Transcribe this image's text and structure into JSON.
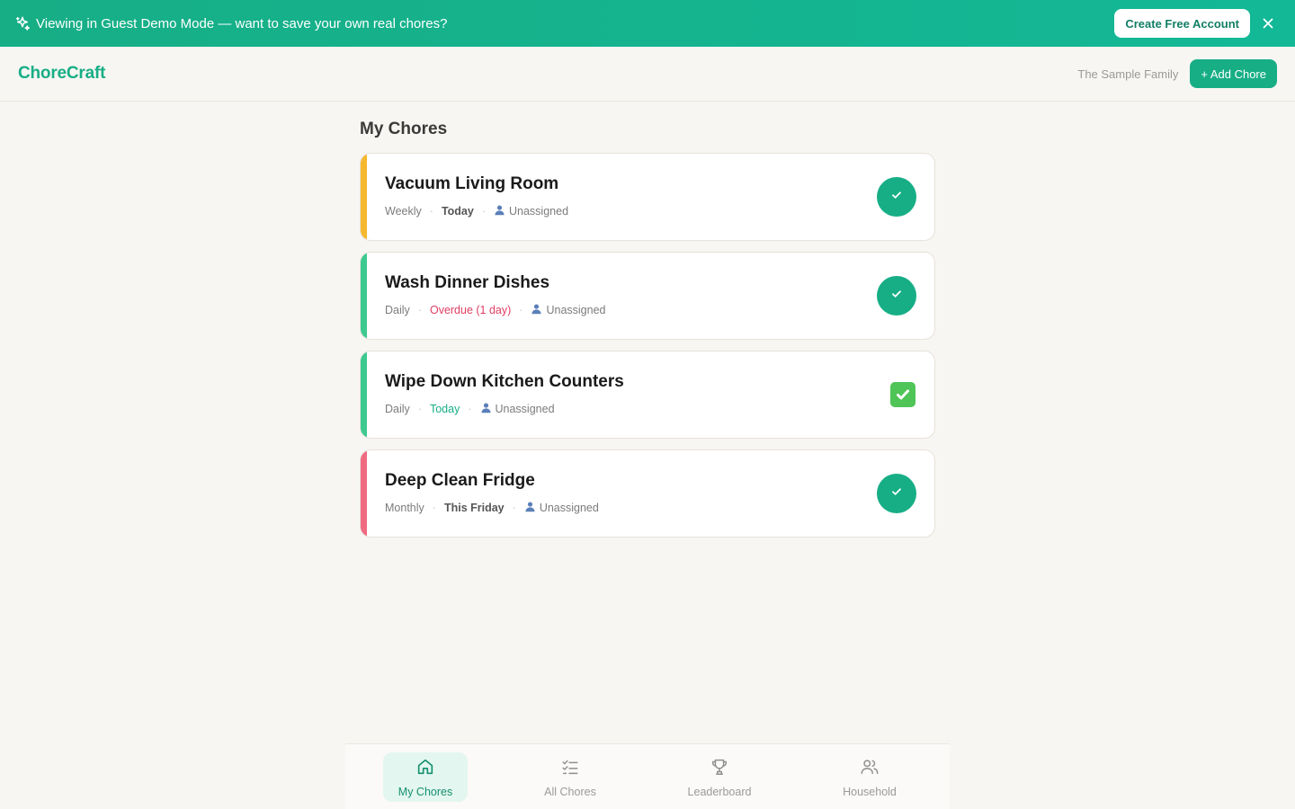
{
  "banner": {
    "message": "Viewing in Guest Demo Mode — want to save your own real chores?",
    "cta_label": "Create Free Account",
    "icon": "sparkle-icon",
    "close_icon": "close-icon"
  },
  "header": {
    "brand": "ChoreCraft",
    "family_name": "The Sample Family",
    "add_label": "+ Add Chore"
  },
  "main": {
    "title": "My Chores",
    "chores": [
      {
        "title": "Vacuum Living Room",
        "frequency": "Weekly",
        "due": "Today",
        "assignee": "Unassigned",
        "accent": "#f5b82e",
        "due_style": "bold",
        "completed": false
      },
      {
        "title": "Wash Dinner Dishes",
        "frequency": "Daily",
        "due": "Overdue (1 day)",
        "assignee": "Unassigned",
        "accent": "#3dc98f",
        "due_style": "overdue",
        "completed": false
      },
      {
        "title": "Wipe Down Kitchen Counters",
        "frequency": "Daily",
        "due": "Today",
        "assignee": "Unassigned",
        "accent": "#3dc98f",
        "due_style": "green",
        "completed": true
      },
      {
        "title": "Deep Clean Fridge",
        "frequency": "Monthly",
        "due": "This Friday",
        "assignee": "Unassigned",
        "accent": "#ef6b80",
        "due_style": "bold",
        "completed": false
      }
    ]
  },
  "nav": {
    "items": [
      {
        "label": "My Chores",
        "icon": "home-icon",
        "active": true
      },
      {
        "label": "All Chores",
        "icon": "checklist-icon",
        "active": false
      },
      {
        "label": "Leaderboard",
        "icon": "trophy-icon",
        "active": false
      },
      {
        "label": "Household",
        "icon": "users-icon",
        "active": false
      }
    ]
  },
  "colors": {
    "brand": "#17ae86",
    "overdue": "#e03e62",
    "background": "#f8f6f2"
  }
}
